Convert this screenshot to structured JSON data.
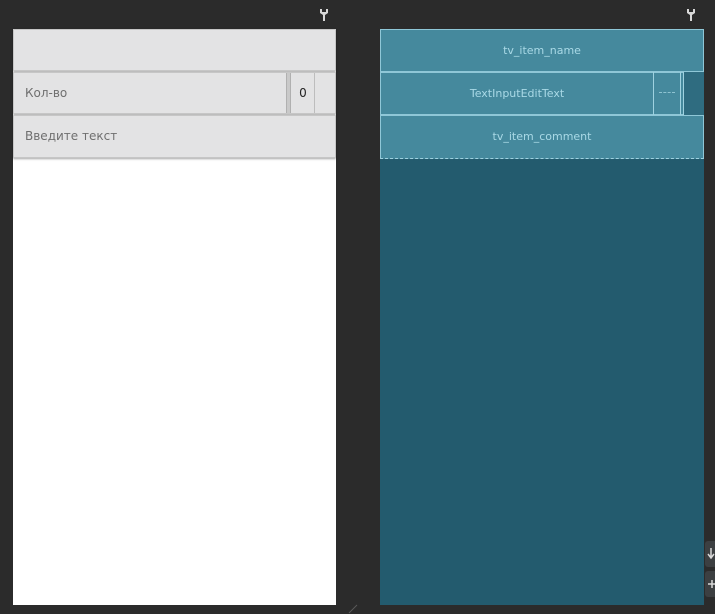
{
  "design": {
    "rows": [
      {
        "label": ""
      },
      {
        "label": "Кол-во",
        "value": "0"
      },
      {
        "label": "Введите текст"
      }
    ]
  },
  "blueprint": {
    "rows": [
      {
        "label": "tv_item_name"
      },
      {
        "label": "TextInputEditText"
      },
      {
        "label": "tv_item_comment"
      }
    ]
  },
  "controls": {
    "pin_icon": "pin-icon",
    "arrow_down_icon": "arrow-down-icon",
    "plus_icon": "plus-icon",
    "resize_icon": "resize-handle-icon"
  },
  "colors": {
    "background": "#2b2b2b",
    "design_row": "#e3e3e4",
    "blueprint_panel": "#235b6e",
    "blueprint_row": "#45899d"
  }
}
